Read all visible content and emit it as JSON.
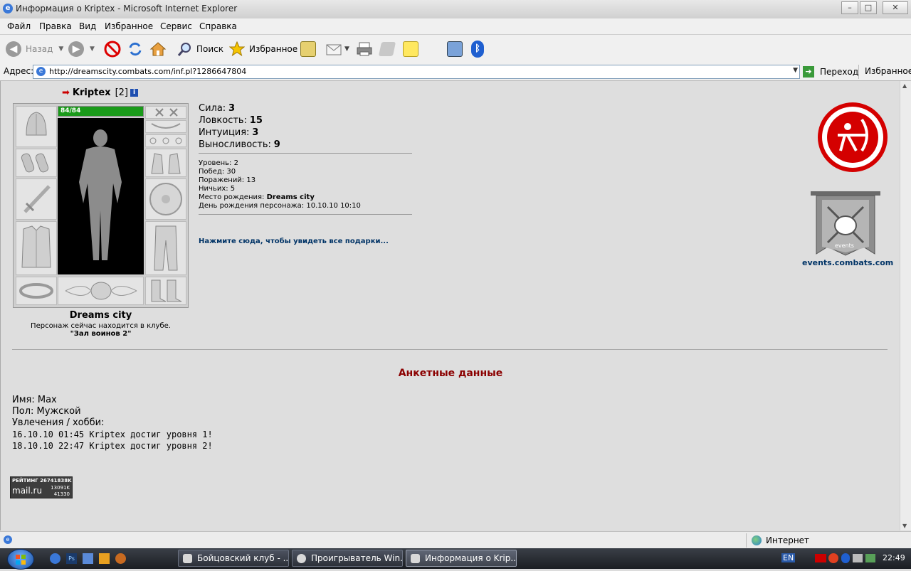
{
  "window": {
    "title": "Информация о Kriptex - Microsoft Internet Explorer"
  },
  "menu": [
    "Файл",
    "Правка",
    "Вид",
    "Избранное",
    "Сервис",
    "Справка"
  ],
  "toolbar": {
    "back_label": "Назад",
    "search_label": "Поиск",
    "favorites_label": "Избранное"
  },
  "address": {
    "label": "Адрес:",
    "url": "http://dreamscity.combats.com/inf.pl?1286647804",
    "go_label": "Переход",
    "favorites_label": "Избранное"
  },
  "character": {
    "name": "Kriptex",
    "level_tag": "[2]",
    "hp": "84/84",
    "city": "Dreams city",
    "location_text": "Персонаж сейчас находится в клубе.",
    "room": "\"Зал воинов 2\""
  },
  "stats": [
    {
      "label": "Сила:",
      "value": "3"
    },
    {
      "label": "Ловкость:",
      "value": "15"
    },
    {
      "label": "Интуиция:",
      "value": "3"
    },
    {
      "label": "Выносливость:",
      "value": "9"
    }
  ],
  "info": {
    "level": "Уровень: 2",
    "wins": "Побед: 30",
    "losses": "Поражений: 13",
    "draws": "Ничьих: 5",
    "birthplace_label": "Место рождения:",
    "birthplace_value": "Dreams city",
    "birthday": "День рождения персонажа: 10.10.10 10:10"
  },
  "gifts_link": "Нажмите сюда, чтобы увидеть все подарки...",
  "events_link": "events.combats.com",
  "events_banner_text": "events",
  "profile": {
    "heading": "Анкетные данные",
    "name": "Имя: Max",
    "gender": "Пол: Мужской",
    "hobbies": "Увлечения / хобби:",
    "log": [
      "16.10.10 01:45 Kriptex достиг уровня 1!",
      "18.10.10 22:47 Kriptex достиг уровня 2!"
    ]
  },
  "counter": {
    "title": "РЕЙТИНГ 26741838K",
    "brand": "mail.ru",
    "line1": "13091K",
    "line2": "41330"
  },
  "status": {
    "zone": "Интернет"
  },
  "taskbar": {
    "tasks": [
      "Бойцовский клуб - ...",
      "Проигрыватель Win...",
      "Информация о Krip..."
    ],
    "lang": "EN",
    "clock": "22:49"
  },
  "colors": {
    "hp_bar": "#1a9a1a",
    "heading": "#8b0000",
    "link": "#003366",
    "archer_red": "#d40000"
  }
}
